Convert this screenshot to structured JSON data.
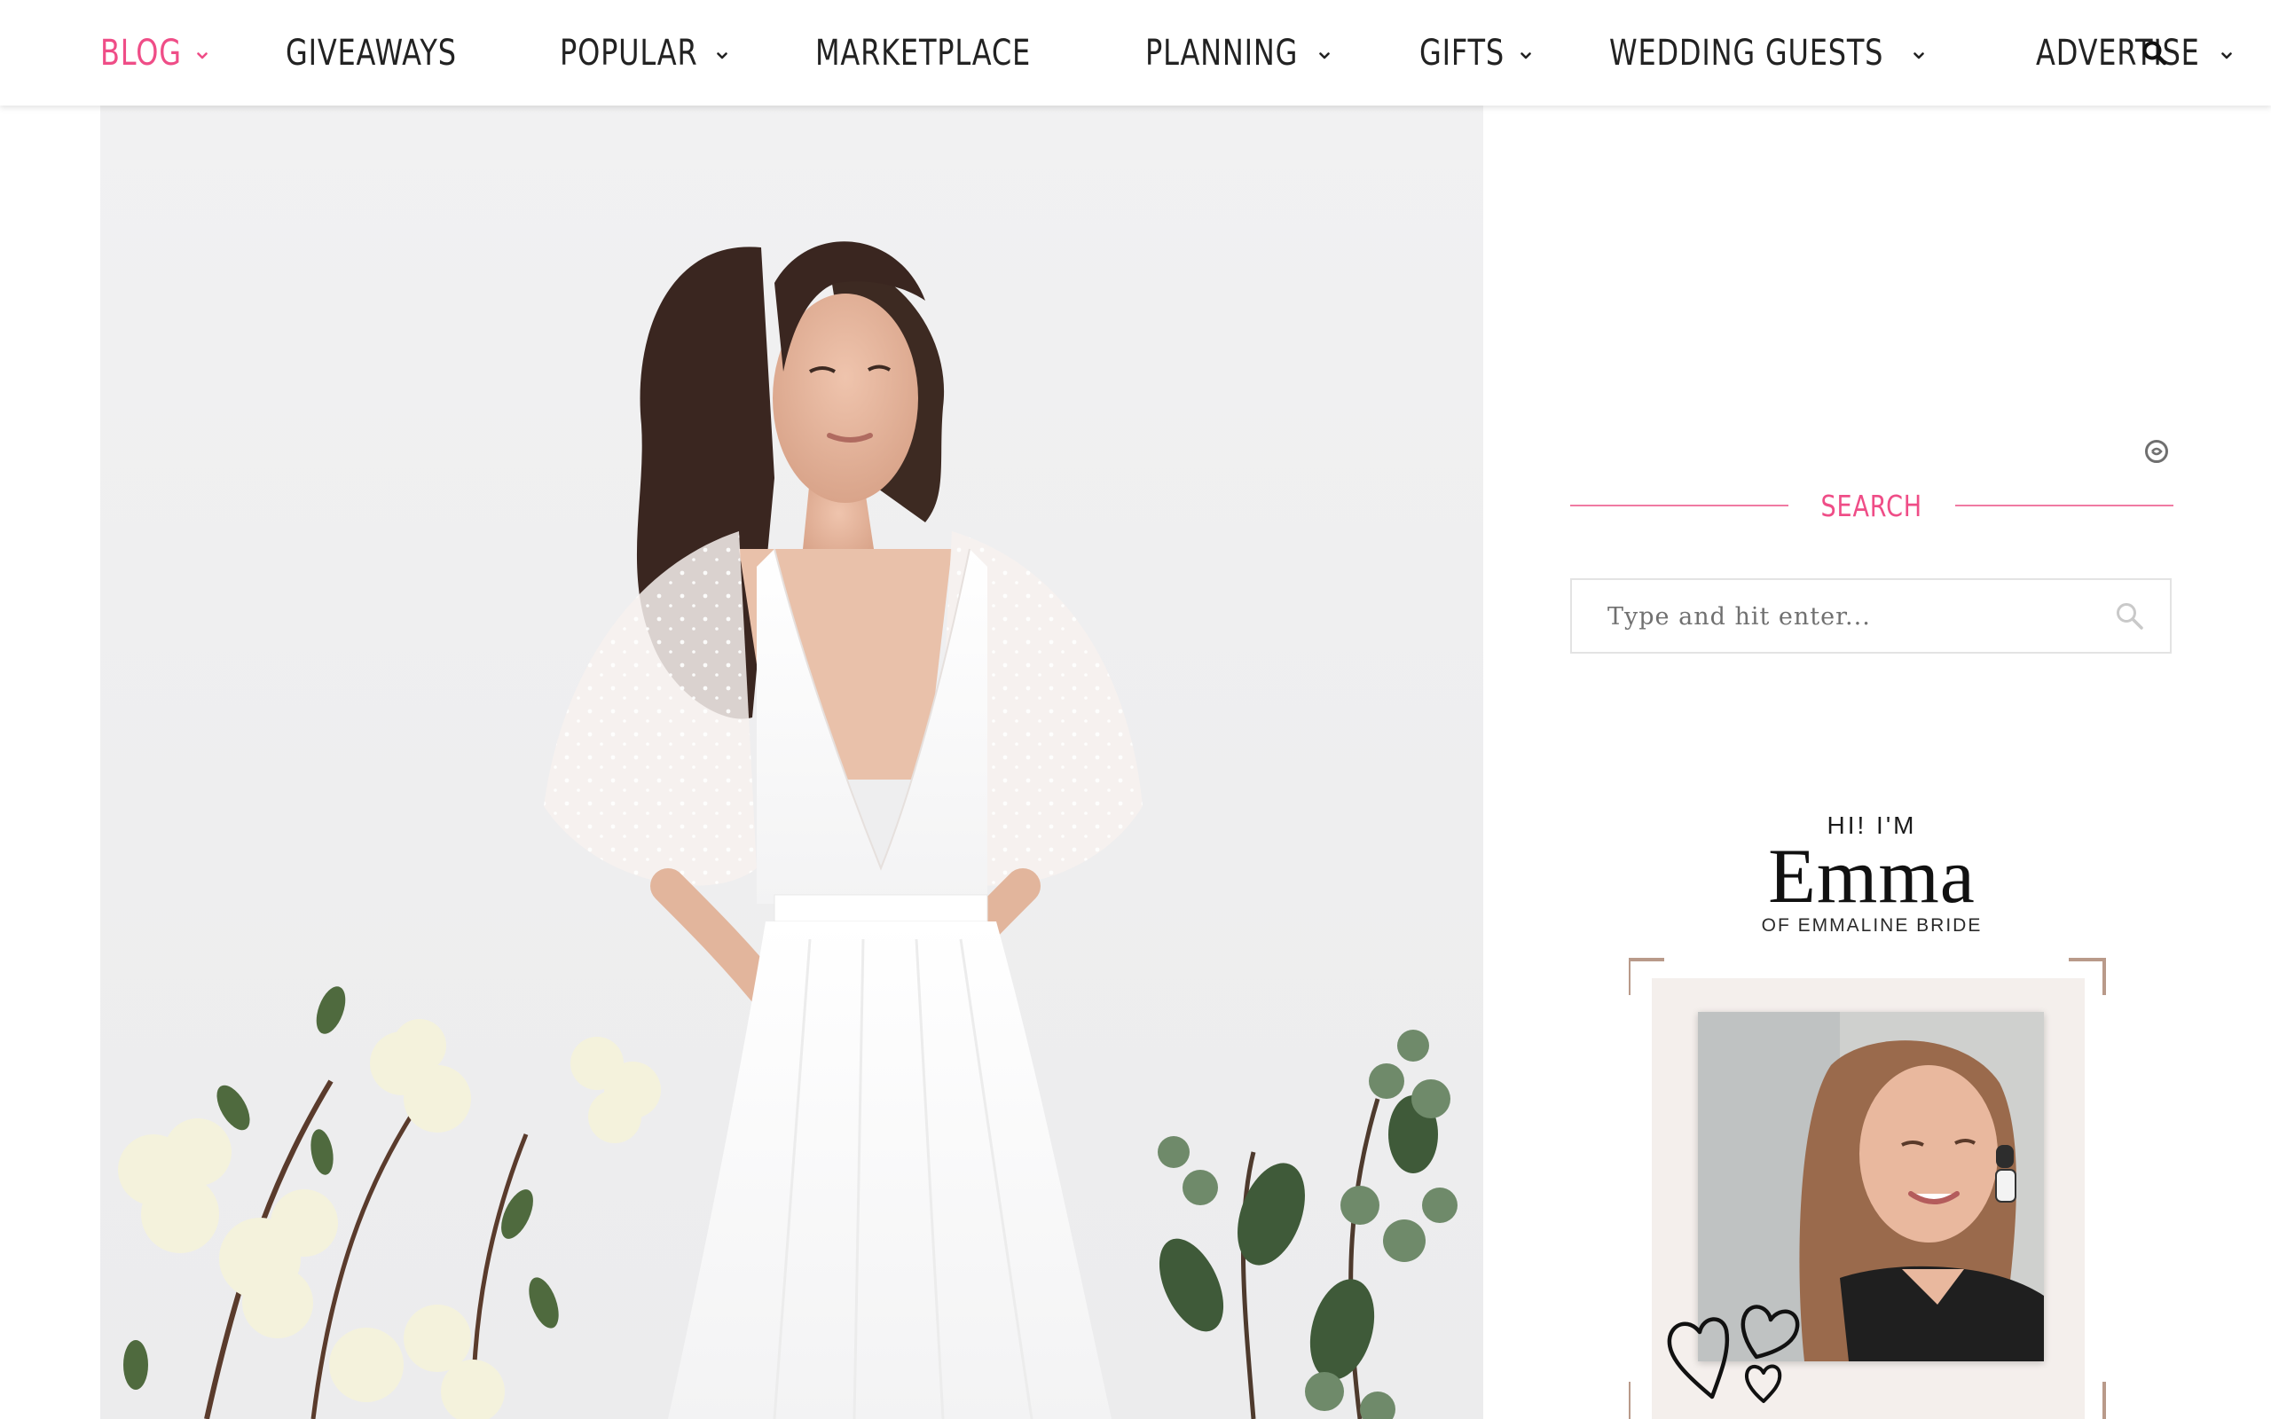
{
  "nav": {
    "items": [
      {
        "label": "BLOG",
        "has_dropdown": true,
        "active": true
      },
      {
        "label": "GIVEAWAYS",
        "has_dropdown": false,
        "active": false
      },
      {
        "label": "POPULAR",
        "has_dropdown": true,
        "active": false
      },
      {
        "label": "MARKETPLACE",
        "has_dropdown": false,
        "active": false
      },
      {
        "label": "PLANNING",
        "has_dropdown": true,
        "active": false
      },
      {
        "label": "GIFTS",
        "has_dropdown": true,
        "active": false
      },
      {
        "label": "WEDDING GUESTS",
        "has_dropdown": true,
        "active": false
      },
      {
        "label": "ADVERTISE",
        "has_dropdown": true,
        "active": false
      }
    ],
    "search_icon": "search-icon",
    "active_color": "#ef4d87",
    "text_color": "#222222"
  },
  "sidebar": {
    "search_widget": {
      "title": "SEARCH",
      "placeholder": "Type and hit enter..."
    },
    "about": {
      "greeting": "HI! I'M",
      "name": "Emma",
      "subtitle": "OF EMMALINE BRIDE"
    },
    "accent_color": "#ef4d87"
  },
  "icons": {
    "ad_choices": "adchoices-icon",
    "search": "search-icon",
    "chevron": "chevron-down-icon",
    "hearts": "hearts-doodle-icon"
  }
}
